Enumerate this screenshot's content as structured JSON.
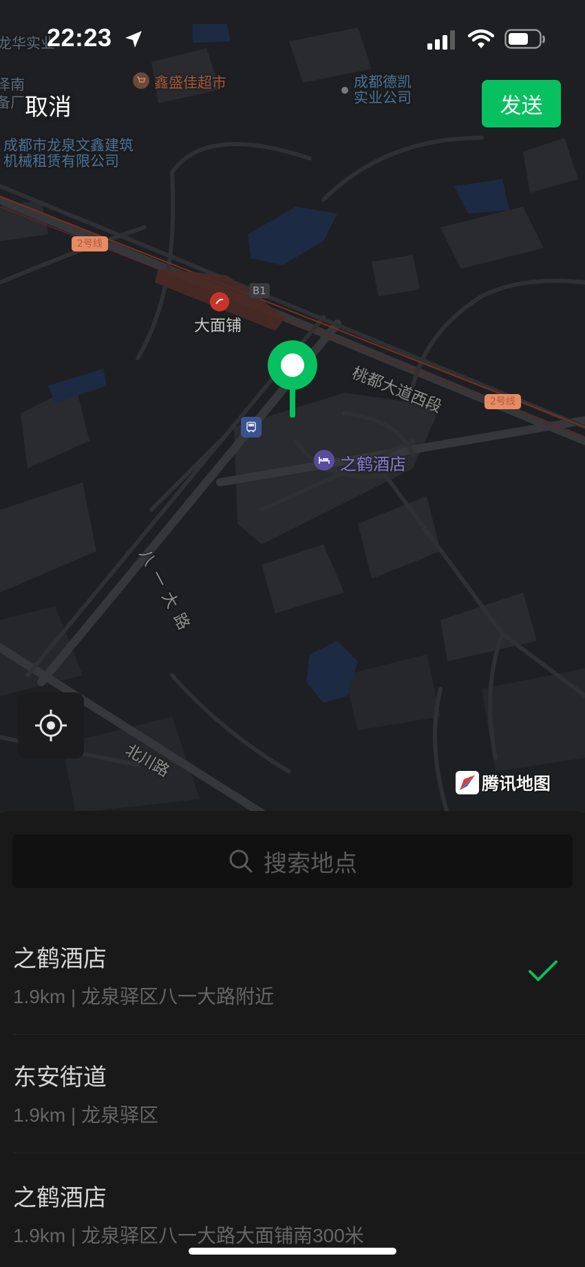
{
  "status_bar": {
    "time": "22:23"
  },
  "top_bar": {
    "cancel_label": "取消",
    "send_label": "发送"
  },
  "map": {
    "labels": {
      "top_left_partial_1": "龙华实业",
      "top_left_partial_2": "泽南",
      "top_left_partial_3": "备厂",
      "supermarket": "鑫盛佳超市",
      "company_top_right": "成都德凯\n实业公司",
      "company_left": "成都市龙泉文鑫建筑\n机械租赁有限公司",
      "metro_station": "大面铺",
      "metro_line_left": "2号线",
      "metro_line_right": "2号线",
      "exit_badge": "B1",
      "road_taodu": "桃都大道西段",
      "hotel": "之鹤酒店",
      "road_bayi": "八一大路",
      "road_beichuan": "北川路"
    },
    "brand_label": "腾讯地图",
    "colors": {
      "pin": "#07c160",
      "water": "#1c2a44",
      "metro": "#7a2f24"
    }
  },
  "search": {
    "placeholder": "搜索地点"
  },
  "places": [
    {
      "name": "之鹤酒店",
      "detail": "1.9km | 龙泉驿区八一大路附近",
      "selected": true
    },
    {
      "name": "东安街道",
      "detail": "1.9km | 龙泉驿区",
      "selected": false
    },
    {
      "name": "之鹤酒店",
      "detail": "1.9km | 龙泉驿区八一大路大面铺南300米",
      "selected": false
    }
  ],
  "accent_color": "#07c160"
}
